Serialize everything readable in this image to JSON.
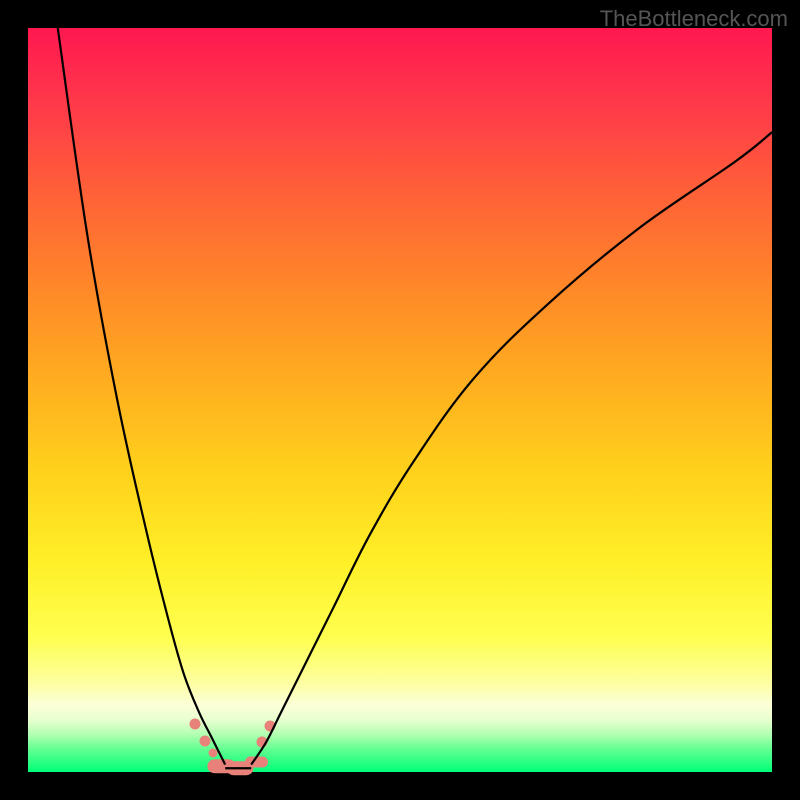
{
  "watermark": "TheBottleneck.com",
  "chart_data": {
    "type": "line",
    "title": "",
    "xlabel": "",
    "ylabel": "",
    "xlim": [
      0,
      100
    ],
    "ylim": [
      0,
      100
    ],
    "background_gradient": {
      "top_color": "#ff1850",
      "mid_colors": [
        "#ff6a30",
        "#ffb020",
        "#ffe820",
        "#ffff60",
        "#fcffb0"
      ],
      "bottom_color": "#00ff80"
    },
    "series": [
      {
        "name": "left-curve",
        "x": [
          4,
          8,
          12,
          16,
          19,
          21,
          23,
          24.5,
          25.5,
          26.5
        ],
        "y": [
          100,
          72,
          50,
          32,
          20,
          13,
          8,
          5,
          3,
          1
        ]
      },
      {
        "name": "right-curve",
        "x": [
          30,
          32,
          34,
          37,
          41,
          46,
          52,
          60,
          70,
          82,
          95,
          100
        ],
        "y": [
          1,
          4,
          8,
          14,
          22,
          32,
          42,
          53,
          63,
          73,
          82,
          86
        ]
      },
      {
        "name": "bottom-segment",
        "x": [
          26.5,
          30
        ],
        "y": [
          0.5,
          0.5
        ]
      }
    ],
    "markers": [
      {
        "x": 22.5,
        "y": 6.5,
        "size": 11
      },
      {
        "x": 23.8,
        "y": 4.2,
        "size": 11
      },
      {
        "x": 24.8,
        "y": 2.5,
        "size": 9
      },
      {
        "x": 26.0,
        "y": 0.8,
        "size": 16,
        "elongated": true
      },
      {
        "x": 28.5,
        "y": 0.5,
        "size": 16,
        "elongated": true
      },
      {
        "x": 30.7,
        "y": 1.4,
        "size": 13,
        "elongated": true
      },
      {
        "x": 31.5,
        "y": 4.0,
        "size": 11
      },
      {
        "x": 32.5,
        "y": 6.2,
        "size": 11
      }
    ]
  }
}
